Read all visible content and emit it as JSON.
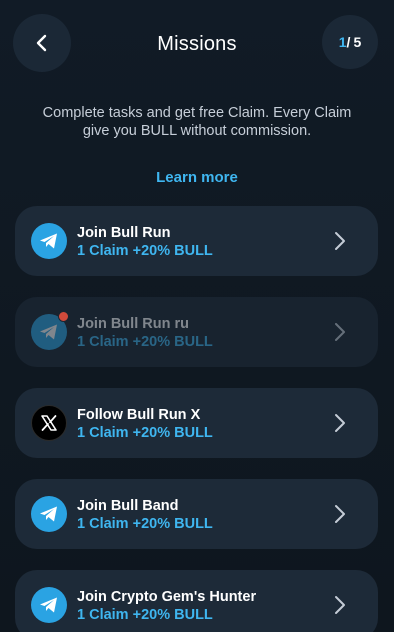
{
  "header": {
    "title": "Missions",
    "counter_current": "1",
    "counter_sep": "/",
    "counter_total": "5"
  },
  "intro": {
    "description": "Complete tasks and get free Claim. Every Claim give you BULL without commission.",
    "learn_more": "Learn more"
  },
  "colors": {
    "accent": "#3fb6f0",
    "card_bg": "#1d2a38",
    "background": "#101a24",
    "telegram": "#2aa3e3",
    "badge": "#d04a3b"
  },
  "missions": [
    {
      "title": "Join Bull Run",
      "reward": "1 Claim +20% BULL",
      "icon": "telegram-icon",
      "state": "active"
    },
    {
      "title": "Join Bull Run ru",
      "reward": "1 Claim +20% BULL",
      "icon": "telegram-icon",
      "state": "disabled"
    },
    {
      "title": "Follow Bull Run X",
      "reward": "1 Claim +20% BULL",
      "icon": "x-logo-icon",
      "state": "active"
    },
    {
      "title": "Join Bull Band",
      "reward": "1 Claim +20% BULL",
      "icon": "telegram-icon",
      "state": "active"
    },
    {
      "title": "Join Crypto Gem's Hunter",
      "reward": "1 Claim +20% BULL",
      "icon": "telegram-icon",
      "state": "active"
    }
  ]
}
